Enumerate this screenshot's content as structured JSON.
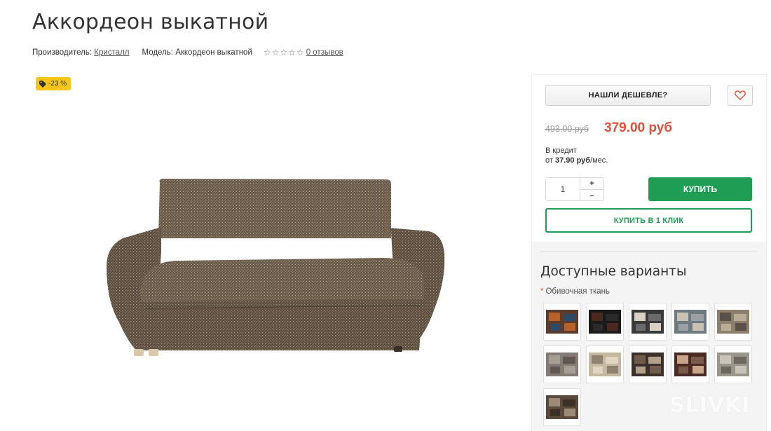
{
  "product": {
    "title": "Аккордеон выкатной",
    "manufacturer_label": "Производитель:",
    "manufacturer": "Кристалл",
    "model_label": "Модель:",
    "model": "Аккордеон выкатной",
    "rating_stars": 0,
    "reviews": "0 отзывов",
    "discount_badge": "-23 %"
  },
  "sidebar": {
    "found_cheaper": "НАШЛИ ДЕШЕВЛЕ?",
    "old_price": "493.00 руб",
    "new_price": "379.00 руб",
    "credit_line1": "В кредит",
    "credit_prefix": "от",
    "credit_amount": "37.90 руб",
    "credit_suffix": "/мес.",
    "quantity": "1",
    "qty_plus": "+",
    "qty_minus": "–",
    "buy": "КУПИТЬ",
    "buy_one_click": "КУПИТЬ В 1 КЛИК",
    "variants_title": "Доступные варианты",
    "fabric_label": "Обивочная ткань",
    "required_mark": "*"
  },
  "swatches": [
    {
      "name": "fabric-swatch-1",
      "colors": [
        "#5b3b2e",
        "#b8622a",
        "#2d4a66"
      ]
    },
    {
      "name": "fabric-swatch-2",
      "colors": [
        "#1a1a1a",
        "#4a2a20",
        "#2a2a2a"
      ]
    },
    {
      "name": "fabric-swatch-3",
      "colors": [
        "#3a3a3a",
        "#d8d0c4",
        "#6a6a6a"
      ]
    },
    {
      "name": "fabric-swatch-4",
      "colors": [
        "#6f7a80",
        "#c9c2b4",
        "#9aa0a4"
      ]
    },
    {
      "name": "fabric-swatch-5",
      "colors": [
        "#8d7f6d",
        "#5a5248",
        "#b9ad98"
      ]
    },
    {
      "name": "fabric-swatch-6",
      "colors": [
        "#847c74",
        "#a59e94",
        "#5f5750"
      ]
    },
    {
      "name": "fabric-swatch-7",
      "colors": [
        "#c5b8a0",
        "#8f8270",
        "#e0d6c2"
      ]
    },
    {
      "name": "fabric-swatch-8",
      "colors": [
        "#3d2f2a",
        "#6f5c4c",
        "#b2a18a"
      ]
    },
    {
      "name": "fabric-swatch-9",
      "colors": [
        "#4a2a22",
        "#c8a48a",
        "#7a5a48"
      ]
    },
    {
      "name": "fabric-swatch-10",
      "colors": [
        "#9a948a",
        "#c9c4ba",
        "#6c6860"
      ]
    },
    {
      "name": "fabric-swatch-11",
      "colors": [
        "#5a4a3c",
        "#9b8a76",
        "#3a3028"
      ]
    }
  ],
  "colors": {
    "accent_green": "#1f9d55",
    "price_red": "#e0503b",
    "badge_yellow": "#f5c518",
    "sofa_fabric": "#7a6a58"
  },
  "watermark": "SLIVKI"
}
